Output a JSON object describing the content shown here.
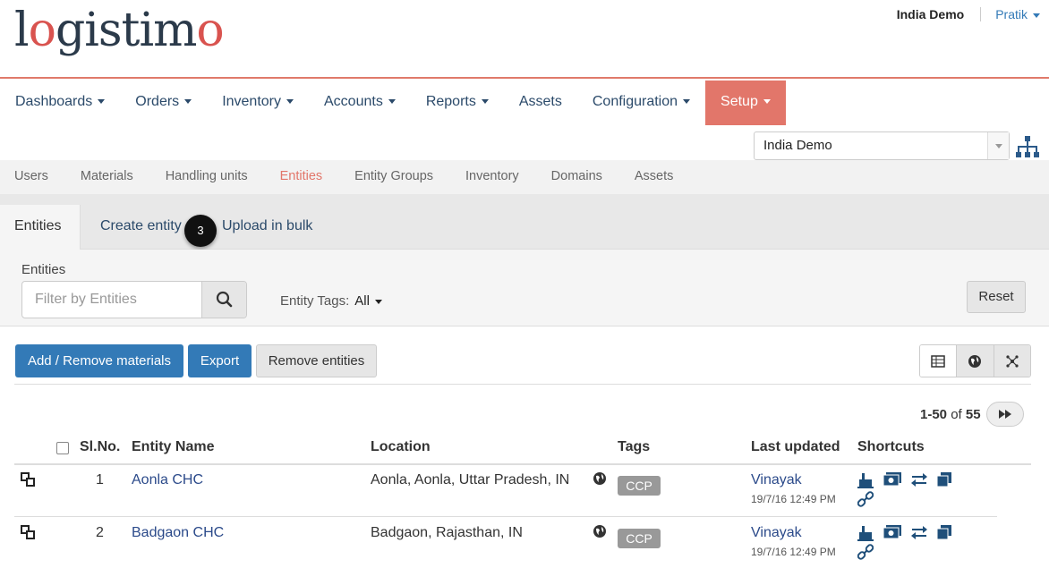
{
  "header": {
    "logo_text_1": "l",
    "logo_text_2": "o",
    "logo_text_3": "gistim",
    "logo_text_4": "o",
    "domain": "India Demo",
    "user": "Pratik"
  },
  "main_nav": [
    "Dashboards",
    "Orders",
    "Inventory",
    "Accounts",
    "Reports",
    "Assets",
    "Configuration",
    "Setup"
  ],
  "domain_select": {
    "value": "India Demo"
  },
  "sub_nav": [
    "Users",
    "Materials",
    "Handling units",
    "Entities",
    "Entity Groups",
    "Inventory",
    "Domains",
    "Assets"
  ],
  "tabs": [
    "Entities",
    "Create entity",
    "Upload in bulk"
  ],
  "step_badge": "3",
  "filter": {
    "label": "Entities",
    "placeholder": "Filter by Entities",
    "tags_label": "Entity Tags:",
    "tags_value": "All",
    "reset": "Reset"
  },
  "actions": {
    "add_remove": "Add / Remove materials",
    "export": "Export",
    "remove": "Remove entities"
  },
  "pagination": {
    "range": "1-50",
    "of": "of",
    "total": "55"
  },
  "table": {
    "headers": [
      "Sl.No.",
      "Entity Name",
      "Location",
      "Tags",
      "Last updated",
      "Shortcuts"
    ],
    "rows": [
      {
        "sl": "1",
        "name": "Aonla CHC",
        "location": "Aonla, Aonla, Uttar Pradesh, IN",
        "tag": "CCP",
        "user": "Vinayak",
        "date": "19/7/16 12:49 PM"
      },
      {
        "sl": "2",
        "name": "Badgaon CHC",
        "location": "Badgaon, Rajasthan, IN",
        "tag": "CCP",
        "user": "Vinayak",
        "date": "19/7/16 12:49 PM"
      }
    ]
  },
  "colors": {
    "accent": "#e2766a",
    "primary": "#337ab7",
    "link": "#2b4a8a"
  }
}
